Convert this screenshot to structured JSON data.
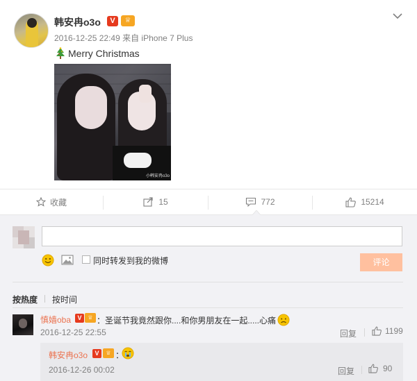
{
  "post": {
    "author": "韩安冉o3o",
    "badge_verified": "V",
    "badge_member": "会员",
    "timestamp": "2016-12-25 22:49",
    "source": "来自 iPhone 7 Plus",
    "text": "Merry Christmas",
    "photo_watermark": "小韩安冉o3o",
    "icons": {
      "avatar": "user-avatar",
      "menu": "chevron-down-icon",
      "emoji": "christmas-tree-icon"
    }
  },
  "actions": {
    "favorite": {
      "label": "收藏",
      "icon": "star-icon"
    },
    "forward": {
      "label": "15",
      "icon": "share-icon"
    },
    "comment": {
      "label": "772",
      "icon": "comment-icon"
    },
    "like": {
      "label": "15214",
      "icon": "thumbs-up-icon"
    }
  },
  "compose": {
    "input_value": "",
    "forward_label": "同时转发到我的微博",
    "submit_label": "评论",
    "icons": {
      "emoji": "smile-icon",
      "image": "image-icon"
    }
  },
  "sort": {
    "hot": "按热度",
    "time": "按时间"
  },
  "comments": [
    {
      "author": "慎嫱oba",
      "badge_verified": "V",
      "badge_member": "会员",
      "text": "：圣诞节我竟然跟你....和你男朋友在一起.....心痛",
      "emoji": "sad-face-icon",
      "time": "2016-12-25 22:55",
      "reply_label": "回复",
      "likes": "1199",
      "replies": [
        {
          "author": "韩安冉o3o",
          "badge_verified": "V",
          "badge_member": "会员",
          "text": "：",
          "emoji": "crying-face-icon",
          "time": "2016-12-26 00:02",
          "reply_label": "回复",
          "likes": "90"
        }
      ]
    }
  ],
  "colors": {
    "accent": "#eb7350",
    "button_disabled": "#ffc09f",
    "muted_text": "#808080",
    "comment_bg": "#f2f2f5"
  }
}
